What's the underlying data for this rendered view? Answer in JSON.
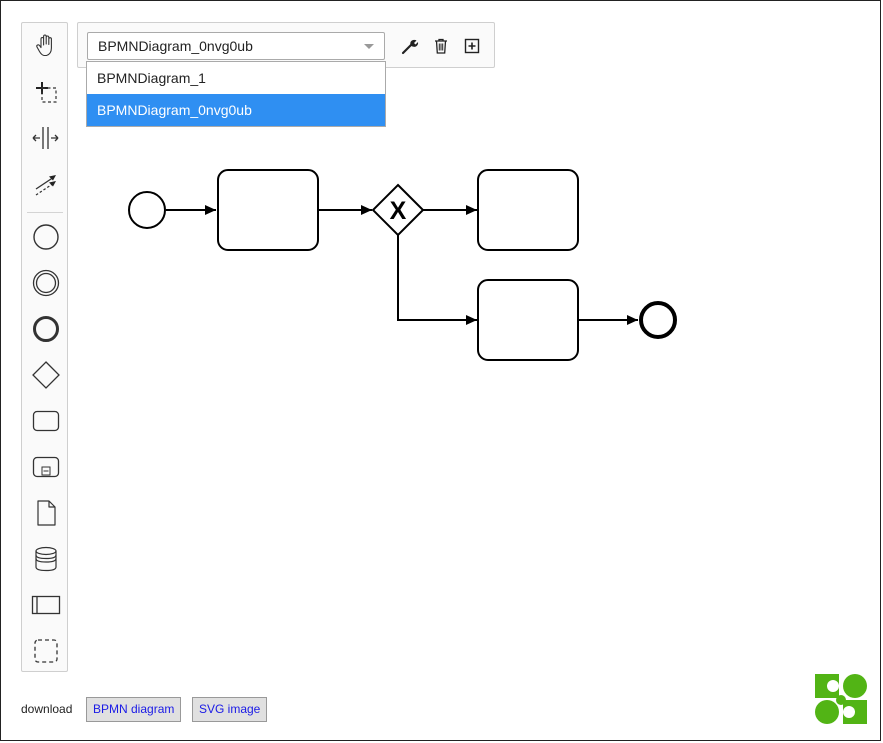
{
  "diagram_select": {
    "current": "BPMNDiagram_0nvg0ub",
    "options": [
      "BPMNDiagram_1",
      "BPMNDiagram_0nvg0ub"
    ],
    "selected_index": 1
  },
  "palette": {
    "tools": [
      "hand-tool-icon",
      "lasso-tool-icon",
      "space-tool-icon",
      "global-connect-tool-icon",
      "start-event-icon",
      "intermediate-event-icon",
      "end-event-icon",
      "gateway-icon",
      "task-icon",
      "subprocess-icon",
      "data-object-icon",
      "data-store-icon",
      "participant-icon",
      "group-icon"
    ]
  },
  "toolbar": {
    "buttons": [
      "wrench-icon",
      "trash-icon",
      "add-diagram-icon"
    ]
  },
  "diagram": {
    "gateway_marker": "X"
  },
  "footer": {
    "download_label": "download",
    "bpmn_button": "BPMN diagram",
    "svg_button": "SVG image"
  },
  "colors": {
    "selected_option": "#2f8ff2",
    "link_text": "#1a1ae6",
    "logo_green": "#52b415"
  }
}
